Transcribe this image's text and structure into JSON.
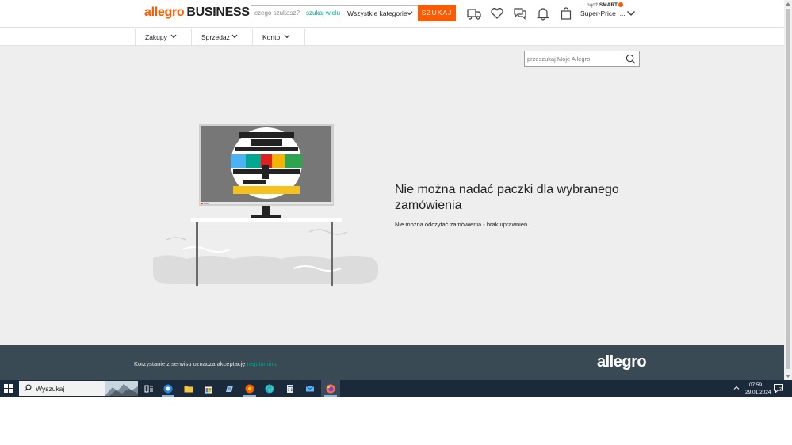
{
  "header": {
    "logo_main": "allegro",
    "logo_suffix": "BUSINESS",
    "search_placeholder": "czego szukasz?",
    "search_many": "szukaj wielu",
    "category": "Wszystkie kategorie",
    "search_button": "SZUKAJ",
    "smart_prefix": "bądź ",
    "smart_brand": "SMART",
    "account_name": "Super-Price_..."
  },
  "nav": {
    "items": [
      {
        "label": "Zakupy"
      },
      {
        "label": "Sprzedaż"
      },
      {
        "label": "Konto"
      }
    ]
  },
  "main": {
    "search_placeholder": "przeszukaj Moje Allegro",
    "error_title": "Nie można nadać paczki dla wybranego zamówienia",
    "error_description": "Nie można odczytać zamówienia - brak uprawnień."
  },
  "footer": {
    "text": "Korzystanie z serwisu oznacza akceptację",
    "link": "regulaminu",
    "logo": "allegro"
  },
  "taskbar": {
    "search_text": "Wyszukaj",
    "time": "07:59",
    "date": "29.01.2024",
    "notification_count": "2"
  },
  "colors": {
    "brand_orange": "#ff5a00",
    "link_teal": "#00a790",
    "footer_bg": "#394a54",
    "main_bg": "#eeeeee"
  }
}
